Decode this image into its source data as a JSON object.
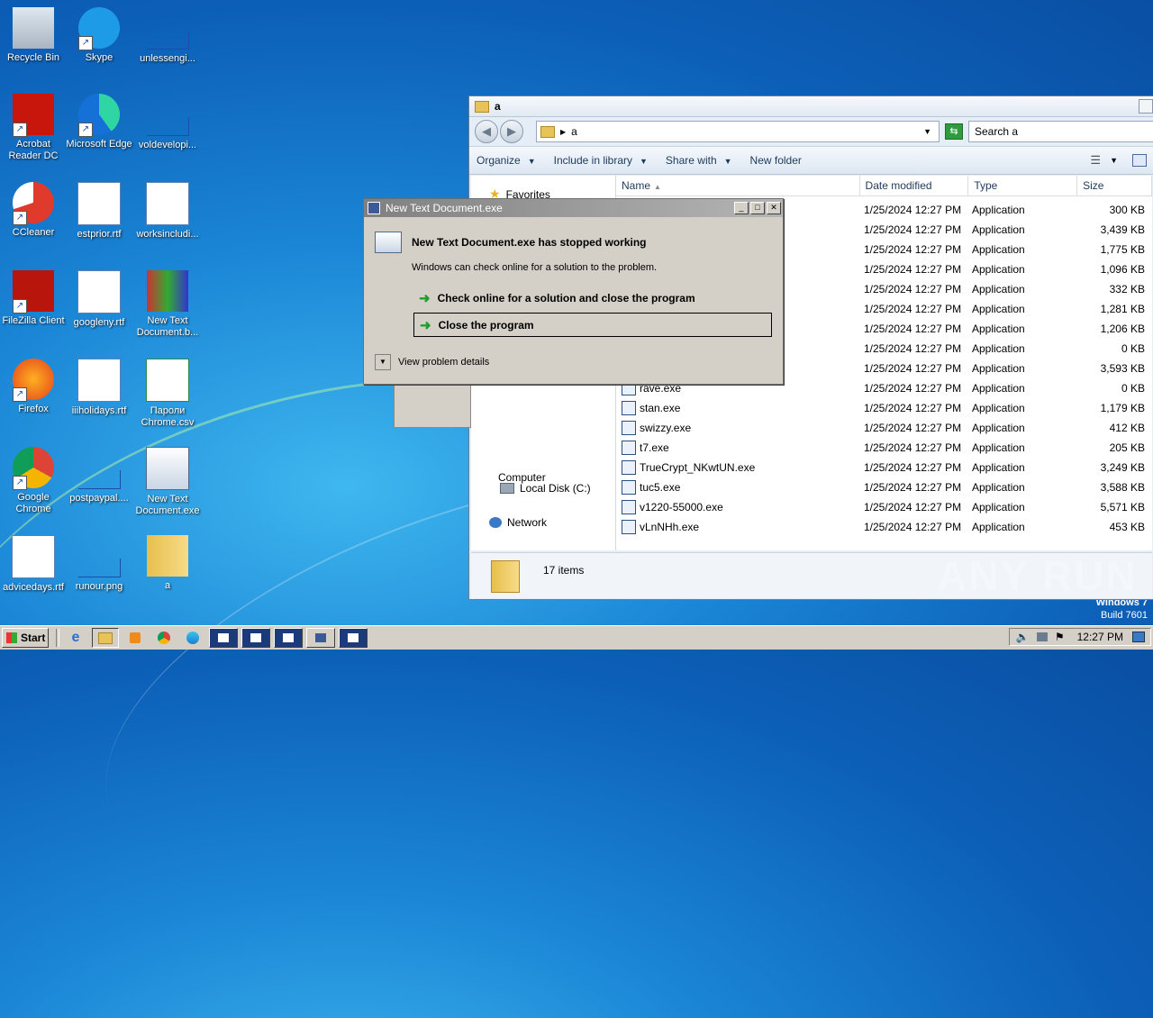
{
  "desktop": {
    "icons": [
      {
        "label": "Recycle Bin"
      },
      {
        "label": "Skype"
      },
      {
        "label": "unlessengi..."
      },
      {
        "label": "Acrobat Reader DC"
      },
      {
        "label": "Microsoft Edge"
      },
      {
        "label": "voldevelopi..."
      },
      {
        "label": "CCleaner"
      },
      {
        "label": "estprior.rtf"
      },
      {
        "label": "worksincludi..."
      },
      {
        "label": "FileZilla Client"
      },
      {
        "label": "googleny.rtf"
      },
      {
        "label": "New Text Document.b..."
      },
      {
        "label": "Firefox"
      },
      {
        "label": "iiiholidays.rtf"
      },
      {
        "label": "Пароли Chrome.csv"
      },
      {
        "label": "Google Chrome"
      },
      {
        "label": "postpaypal...."
      },
      {
        "label": "New Text Document.exe"
      },
      {
        "label": "advicedays.rtf"
      },
      {
        "label": "runour.png"
      },
      {
        "label": "a"
      }
    ],
    "watermark": {
      "line1": "Windows 7",
      "line2": "Build 7601"
    },
    "anyrun": "ANY RUN"
  },
  "explorer": {
    "title": "a",
    "address": "a",
    "search_placeholder": "Search a",
    "toolbar": {
      "organize": "Organize",
      "include": "Include in library",
      "share": "Share with",
      "new_folder": "New folder"
    },
    "nav": {
      "favorites": "Favorites",
      "computer": "Computer",
      "local_disk": "Local Disk (C:)",
      "network": "Network"
    },
    "columns": {
      "name": "Name",
      "date": "Date modified",
      "type": "Type",
      "size": "Size"
    },
    "files": [
      {
        "name": "",
        "date": "1/25/2024 12:27 PM",
        "type": "Application",
        "size": "300 KB"
      },
      {
        "name": "",
        "date": "1/25/2024 12:27 PM",
        "type": "Application",
        "size": "3,439 KB"
      },
      {
        "name": "",
        "date": "1/25/2024 12:27 PM",
        "type": "Application",
        "size": "1,775 KB"
      },
      {
        "name": "",
        "date": "1/25/2024 12:27 PM",
        "type": "Application",
        "size": "1,096 KB"
      },
      {
        "name": "",
        "date": "1/25/2024 12:27 PM",
        "type": "Application",
        "size": "332 KB"
      },
      {
        "name": "",
        "date": "1/25/2024 12:27 PM",
        "type": "Application",
        "size": "1,281 KB"
      },
      {
        "name": "",
        "date": "1/25/2024 12:27 PM",
        "type": "Application",
        "size": "1,206 KB"
      },
      {
        "name": "",
        "date": "1/25/2024 12:27 PM",
        "type": "Application",
        "size": "0 KB"
      },
      {
        "name": "",
        "date": "1/25/2024 12:27 PM",
        "type": "Application",
        "size": "3,593 KB"
      },
      {
        "name": "rave.exe",
        "date": "1/25/2024 12:27 PM",
        "type": "Application",
        "size": "0 KB"
      },
      {
        "name": "stan.exe",
        "date": "1/25/2024 12:27 PM",
        "type": "Application",
        "size": "1,179 KB"
      },
      {
        "name": "swizzy.exe",
        "date": "1/25/2024 12:27 PM",
        "type": "Application",
        "size": "412 KB"
      },
      {
        "name": "t7.exe",
        "date": "1/25/2024 12:27 PM",
        "type": "Application",
        "size": "205 KB"
      },
      {
        "name": "TrueCrypt_NKwtUN.exe",
        "date": "1/25/2024 12:27 PM",
        "type": "Application",
        "size": "3,249 KB"
      },
      {
        "name": "tuc5.exe",
        "date": "1/25/2024 12:27 PM",
        "type": "Application",
        "size": "3,588 KB"
      },
      {
        "name": "v1220-55000.exe",
        "date": "1/25/2024 12:27 PM",
        "type": "Application",
        "size": "5,571 KB"
      },
      {
        "name": "vLnNHh.exe",
        "date": "1/25/2024 12:27 PM",
        "type": "Application",
        "size": "453 KB"
      }
    ],
    "status": "17 items"
  },
  "dialog": {
    "title": "New Text Document.exe",
    "heading": "New Text Document.exe has stopped working",
    "message": "Windows can check online for a solution to the problem.",
    "option1": "Check online for a solution and close the program",
    "option2": "Close the program",
    "details": "View problem details"
  },
  "taskbar": {
    "start": "Start",
    "clock": "12:27 PM"
  }
}
